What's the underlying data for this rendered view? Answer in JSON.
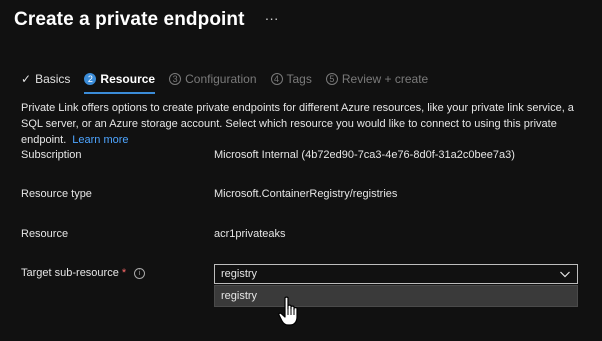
{
  "header": {
    "title": "Create a private endpoint",
    "more": "···"
  },
  "steps": [
    {
      "label": "Basics",
      "number": "",
      "state": "done"
    },
    {
      "label": "Resource",
      "number": "2",
      "state": "active"
    },
    {
      "label": "Configuration",
      "number": "3",
      "state": "inactive"
    },
    {
      "label": "Tags",
      "number": "4",
      "state": "inactive"
    },
    {
      "label": "Review + create",
      "number": "5",
      "state": "inactive"
    }
  ],
  "description": {
    "text": "Private Link offers options to create private endpoints for different Azure resources, like your private link service, a SQL server, or an Azure storage account. Select which resource you would like to connect to using this private endpoint.",
    "link": "Learn more"
  },
  "fields": {
    "subscription": {
      "label": "Subscription",
      "value": "Microsoft Internal (4b72ed90-7ca3-4e76-8d0f-31a2c0bee7a3)"
    },
    "resource_type": {
      "label": "Resource type",
      "value": "Microsoft.ContainerRegistry/registries"
    },
    "resource": {
      "label": "Resource",
      "value": "acr1privateaks"
    },
    "target_sub_resource": {
      "label": "Target sub-resource",
      "required_mark": "*",
      "info_icon": "info-icon",
      "selected": "registry",
      "options": [
        "registry"
      ]
    }
  },
  "colors": {
    "accent": "#3b8cd8",
    "link": "#4ea5ff",
    "background": "#111111",
    "required": "#ff6a6a"
  },
  "icons": {
    "check": "checkmark-icon",
    "chevron": "chevron-down-icon",
    "cursor": "hand-pointer-cursor-icon"
  }
}
